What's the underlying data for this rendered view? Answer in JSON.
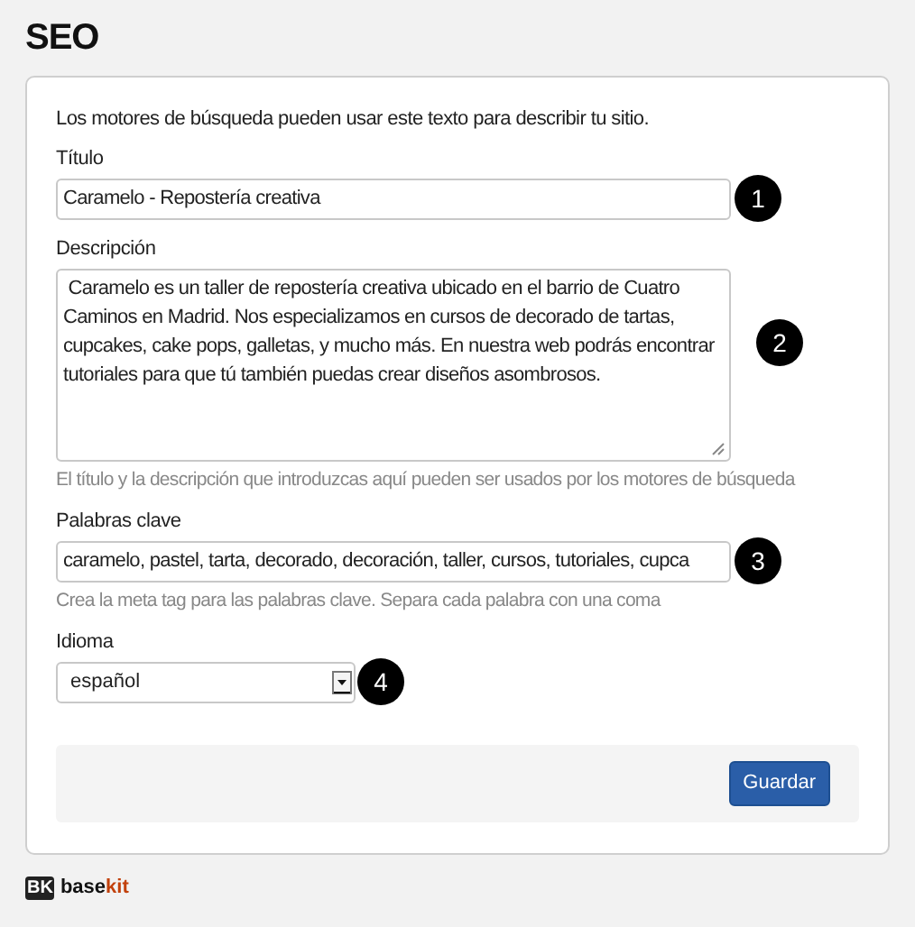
{
  "page_title": "SEO",
  "intro": "Los motores de búsqueda pueden usar este texto para describir tu sitio.",
  "fields": [
    {
      "kind": "text",
      "label": "Título",
      "value": "Caramelo - Repostería creativa",
      "callout": "1"
    },
    {
      "kind": "textarea",
      "label": "Descripción",
      "value": " Caramelo es un taller de repostería creativa ubicado en el barrio de Cuatro Caminos en Madrid. Nos especializamos en cursos de decorado de tartas, cupcakes, cake pops, galletas, y mucho más. En nuestra web podrás encontrar tutoriales para que tú también puedas crear diseños asombrosos.",
      "callout": "2",
      "help": "El título y la descripción que introduzcas aquí pueden ser usados por los motores de búsqueda"
    },
    {
      "kind": "text",
      "label": "Palabras clave",
      "value": "caramelo, pastel, tarta, decorado, decoración, taller, cursos, tutoriales, cupca",
      "callout": "3",
      "help": "Crea la meta tag para las palabras clave. Separa cada palabra con una coma"
    },
    {
      "kind": "select",
      "label": "Idioma",
      "value": "español",
      "callout": "4"
    }
  ],
  "save_button": "Guardar",
  "logo": {
    "mark": "BK",
    "name": "base",
    "accent": "kit"
  }
}
